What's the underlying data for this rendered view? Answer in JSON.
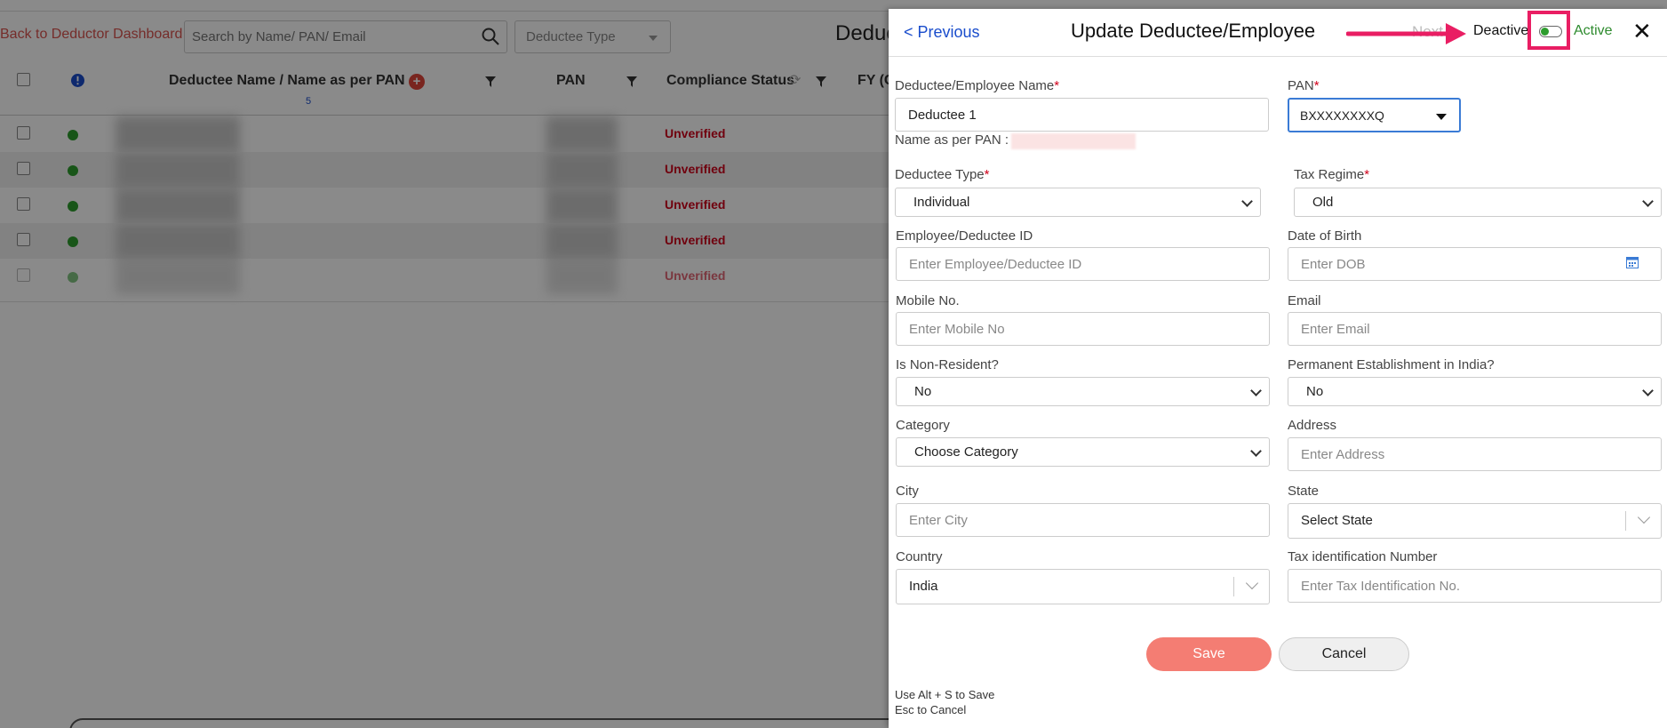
{
  "background": {
    "back_link": "Back to Deductor Dashboard",
    "search_placeholder": "Search by Name/ PAN/ Email",
    "deductee_type_placeholder": "Deductee Type",
    "page_heading": "Deduc",
    "columns": [
      "Deductee Name / Name as per PAN",
      "PAN",
      "Compliance Status",
      "FY (C"
    ],
    "name_count": "5",
    "rows": [
      {
        "status": "Unverified"
      },
      {
        "status": "Unverified"
      },
      {
        "status": "Unverified"
      },
      {
        "status": "Unverified"
      },
      {
        "status": "Unverified"
      }
    ]
  },
  "modal": {
    "previous": "< Previous",
    "title": "Update Deductee/Employee",
    "next": "Next",
    "deactive": "Deactive",
    "active": "Active",
    "close": "✕",
    "fields": {
      "name_label": "Deductee/Employee Name",
      "name_value": "Deductee 1",
      "name_as_per_pan": "Name as per PAN :",
      "pan_label": "PAN",
      "pan_value": "BXXXXXXXXQ",
      "deductee_type_label": "Deductee Type",
      "deductee_type_value": "Individual",
      "tax_regime_label": "Tax Regime",
      "tax_regime_value": "Old",
      "emp_id_label": "Employee/Deductee ID",
      "emp_id_placeholder": "Enter Employee/Deductee ID",
      "dob_label": "Date of Birth",
      "dob_placeholder": "Enter DOB",
      "mobile_label": "Mobile No.",
      "mobile_placeholder": "Enter Mobile No",
      "email_label": "Email",
      "email_placeholder": "Enter Email",
      "non_resident_label": "Is Non-Resident?",
      "non_resident_value": "No",
      "perm_est_label": "Permanent Establishment in India?",
      "perm_est_value": "No",
      "category_label": "Category",
      "category_value": "Choose Category",
      "address_label": "Address",
      "address_placeholder": "Enter Address",
      "city_label": "City",
      "city_placeholder": "Enter City",
      "state_label": "State",
      "state_value": "Select State",
      "country_label": "Country",
      "country_value": "India",
      "tin_label": "Tax identification Number",
      "tin_placeholder": "Enter Tax Identification No."
    },
    "required_mark": "*",
    "save": "Save",
    "cancel": "Cancel",
    "hint_save": "Use Alt + S to Save",
    "hint_cancel": "Esc to Cancel"
  },
  "colors": {
    "accent_link": "#1a4dcc",
    "save_button": "#f47d73",
    "status_unverified": "#d0021b",
    "highlight": "#e91e63",
    "active_green": "#2e8b2e"
  }
}
